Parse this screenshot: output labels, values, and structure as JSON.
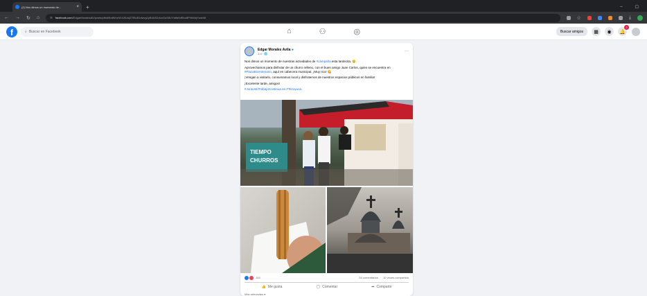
{
  "browser": {
    "tab_title": "(2) Nos dimos un momento de...",
    "tab_close": "×",
    "new_tab": "+",
    "url_host": "facebook.com",
    "url_path": "/EdgarMoralesAV/posts/pfbid0bdWvzhX4JKdq3TfEuB1dwvg1yBUkS2duvGuS8UYtdfa9dEbo8PVkMqYwzbM",
    "win_controls": [
      "–",
      "☐"
    ]
  },
  "facebook_nav": {
    "logo": "f",
    "search_placeholder": "Buscar en Facebook",
    "find_friends_label": "Buscar amigos",
    "notifications_count": "2"
  },
  "post": {
    "author": "Edgar Morales Avila",
    "verified": "●",
    "meta": "1 d · 🌐",
    "more": "···",
    "paragraphs": [
      {
        "pre": "Nos dimos un momento de nuestras actividades de ",
        "tag": "#campaña",
        "post": " esta tardecita. 😊"
      },
      {
        "pre": "Aprovechamos para disfrutar de un churro relleno, con el buen amigo Juan Carlos, quien se encuentra en ",
        "tag": "#PlazaBicentenario",
        "post": ", aquí en cabecera municipal. ¡Muy rico! 😋"
      },
      {
        "pre": "¡Vengan a visitarlo, consumamos local y disfrutemos de nuestros espacios públicos en familia!",
        "tag": "",
        "post": ""
      },
      {
        "pre": "¡Excelente tarde, amigos!",
        "tag": "",
        "post": ""
      },
      {
        "pre": "",
        "tag": "#JuntosElTrabajoContinua",
        "post": " en #Tezoyuca."
      }
    ],
    "image_sign_text": "TIEMPO DE CHURROS",
    "reactions_count": "144",
    "comments_label": "54 comentarios",
    "shares_label": "10 veces compartido",
    "actions": {
      "like": "Me gusta",
      "comment": "Comentar",
      "share": "Compartir"
    },
    "footer_text": "Más relevantes ▾"
  },
  "colors": {
    "facebook_blue": "#1877f2",
    "page_background": "#f0f2f5",
    "browser_dark": "#35363a"
  }
}
